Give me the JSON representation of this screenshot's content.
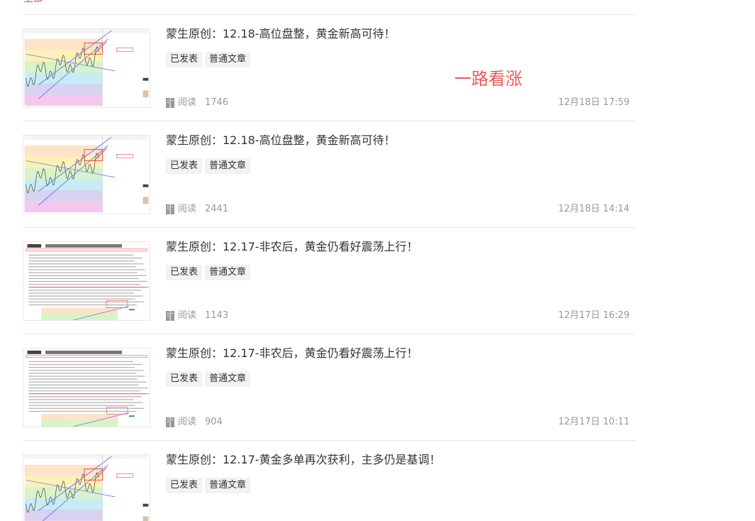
{
  "top_tab": {
    "label": "全部"
  },
  "annotation": {
    "text": "一路看涨",
    "color": "#e85a5a"
  },
  "read_label": "阅读",
  "articles": [
    {
      "title": "蒙生原创：12.18-高位盘整，黄金新高可待！",
      "tags": [
        "已发表",
        "普通文章"
      ],
      "reads": "1746",
      "time": "12月18日 17:59",
      "thumb": "chart"
    },
    {
      "title": "蒙生原创：12.18-高位盘整，黄金新高可待！",
      "tags": [
        "已发表",
        "普通文章"
      ],
      "reads": "2441",
      "time": "12月18日 14:14",
      "thumb": "chart"
    },
    {
      "title": "蒙生原创：12.17-非农后，黄金仍看好震荡上行！",
      "tags": [
        "已发表",
        "普通文章"
      ],
      "reads": "1143",
      "time": "12月17日 16:29",
      "thumb": "doc"
    },
    {
      "title": "蒙生原创：12.17-非农后，黄金仍看好震荡上行！",
      "tags": [
        "已发表",
        "普通文章"
      ],
      "reads": "904",
      "time": "12月17日 10:11",
      "thumb": "doc"
    },
    {
      "title": "蒙生原创：12.17-黄金多单再次获利，主多仍是基调！",
      "tags": [
        "已发表",
        "普通文章"
      ],
      "reads": "",
      "time": "",
      "thumb": "chart"
    }
  ]
}
